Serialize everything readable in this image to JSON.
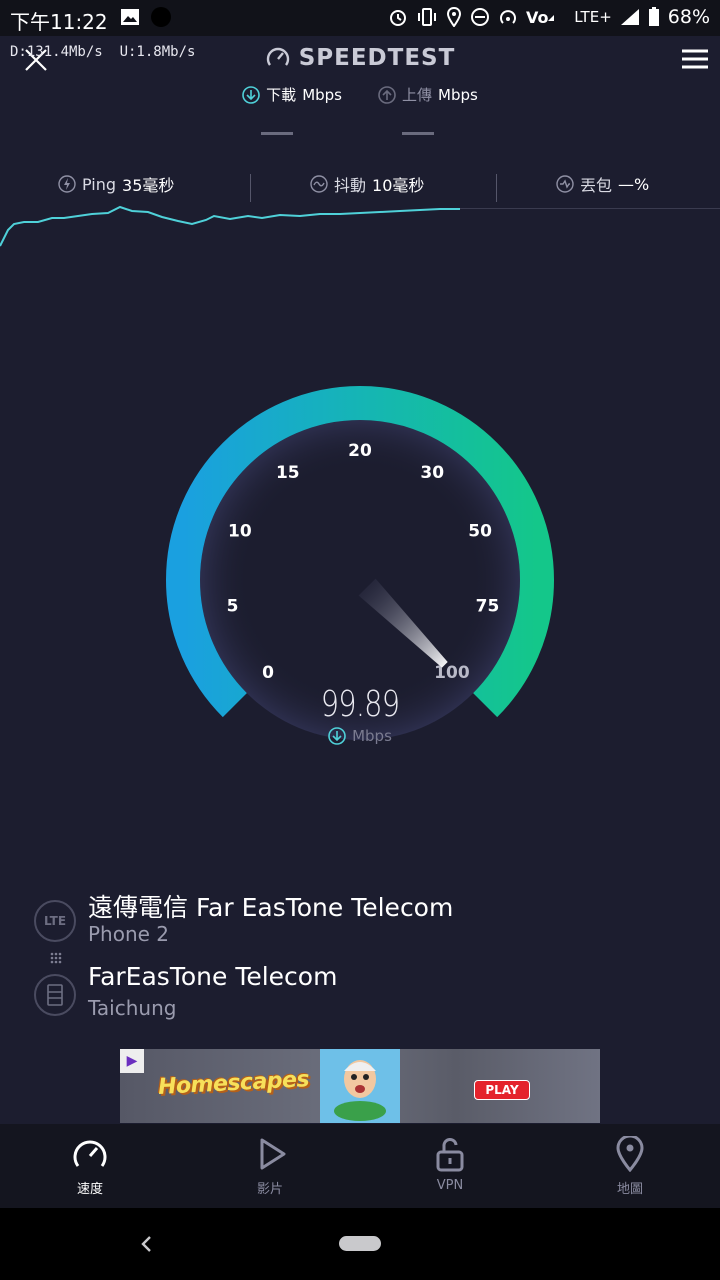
{
  "status_bar": {
    "time": "下午11:22",
    "network": "LTE+",
    "battery": "68%"
  },
  "overlay": {
    "download_rate": "D:131.4Mb/s",
    "upload_rate": "U:1.8Mb/s"
  },
  "header": {
    "brand": "SPEEDTEST",
    "download_label": "下載",
    "download_unit": "Mbps",
    "upload_label": "上傳",
    "upload_unit": "Mbps"
  },
  "metrics": {
    "ping_label": "Ping",
    "ping_value": "35毫秒",
    "jitter_label": "抖動",
    "jitter_value": "10毫秒",
    "loss_label": "丟包",
    "loss_value": "—%"
  },
  "gauge": {
    "ticks": [
      "0",
      "5",
      "10",
      "15",
      "20",
      "30",
      "50",
      "75",
      "100"
    ],
    "speed": "99.89",
    "unit": "Mbps",
    "needle_fraction": 1.0
  },
  "provider": {
    "carrier_name": "遠傳電信 Far EasTone Telecom",
    "carrier_sub": "Phone 2",
    "carrier_badge": "LTE",
    "server_name": "FarEasTone Telecom",
    "server_location": "Taichung"
  },
  "ad": {
    "badge": "▶",
    "logo": "Homescapes",
    "cta": "PLAY"
  },
  "nav": {
    "items": [
      {
        "label": "速度"
      },
      {
        "label": "影片"
      },
      {
        "label": "VPN"
      },
      {
        "label": "地圖"
      }
    ]
  },
  "colors": {
    "background": "#1c1d2f",
    "gauge_start": "#1aa0e0",
    "gauge_end": "#14c78a",
    "accent": "#4fd1d9"
  }
}
